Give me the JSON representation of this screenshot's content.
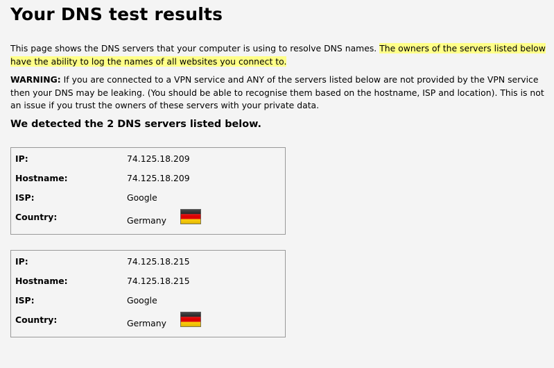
{
  "title": "Your DNS test results",
  "intro": {
    "plain": "This page shows the DNS servers that your computer is using to resolve DNS names. ",
    "highlighted": "The owners of the servers listed below have the ability to log the names of all websites you connect to."
  },
  "warning": {
    "label": "WARNING:",
    "text": " If you are connected to a VPN service and ANY of the servers listed below are not provided by the VPN service then your DNS may be leaking. (You should be able to recognise them based on the hostname, ISP and location). This is not an issue if you trust the owners of these servers with your private data."
  },
  "detected_heading": "We detected the 2 DNS servers listed below.",
  "labels": {
    "ip": "IP:",
    "hostname": "Hostname:",
    "isp": "ISP:",
    "country": "Country:"
  },
  "servers": [
    {
      "ip": "74.125.18.209",
      "hostname": "74.125.18.209",
      "isp": "Google",
      "country": "Germany",
      "flag_icon": "germany-flag-icon"
    },
    {
      "ip": "74.125.18.215",
      "hostname": "74.125.18.215",
      "isp": "Google",
      "country": "Germany",
      "flag_icon": "germany-flag-icon"
    }
  ],
  "colors": {
    "highlight": "#ffff88",
    "page_background": "#f4f4f4",
    "border": "#999999",
    "flag_black": "#000000",
    "flag_red": "#dd0000",
    "flag_gold": "#ffce00"
  }
}
